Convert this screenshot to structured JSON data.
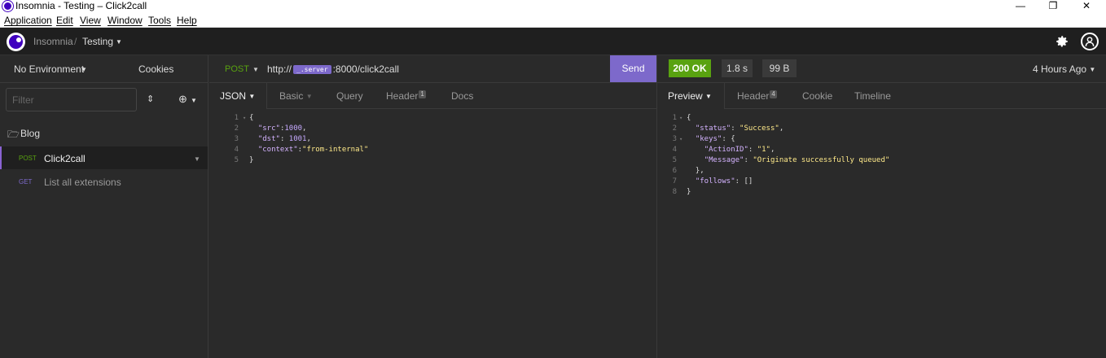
{
  "window": {
    "title": "Insomnia - Testing – Click2call",
    "controls": {
      "minimize": "—",
      "maximize": "❐",
      "close": "✕"
    }
  },
  "menu": [
    "Application",
    "Edit",
    "View",
    "Window",
    "Tools",
    "Help"
  ],
  "header": {
    "workspace_root": "Insomnia",
    "separator": "/",
    "workspace": "Testing",
    "settings_icon": "gear-icon",
    "account_icon": "user-icon"
  },
  "sidebar": {
    "environment": "No Environment",
    "cookies": "Cookies",
    "filter_placeholder": "Filter",
    "folder": "Blog",
    "requests": [
      {
        "method": "POST",
        "name": "Click2call",
        "active": true
      },
      {
        "method": "GET",
        "name": "List all extensions",
        "active": false
      }
    ]
  },
  "request": {
    "method": "POST",
    "url_prefix": "http://",
    "url_variable": "_.server",
    "url_suffix": ":8000/click2call",
    "send_label": "Send",
    "tabs": [
      {
        "label": "JSON",
        "active": true
      },
      {
        "label": "Basic"
      },
      {
        "label": "Query"
      },
      {
        "label": "Header",
        "badge": "1"
      },
      {
        "label": "Docs"
      }
    ],
    "body_lines": [
      "{",
      "  \"src\":1000,",
      "  \"dst\": 1001,",
      "  \"context\":\"from-internal\"",
      "}"
    ],
    "line_numbers": [
      "1",
      "2",
      "3",
      "4",
      "5"
    ]
  },
  "response": {
    "status": "200 OK",
    "status_color": "#59a210",
    "time": "1.8 s",
    "size": "99 B",
    "age": "4 Hours Ago",
    "tabs": [
      {
        "label": "Preview",
        "active": true
      },
      {
        "label": "Header",
        "badge": "4"
      },
      {
        "label": "Cookie"
      },
      {
        "label": "Timeline"
      }
    ],
    "body_lines": [
      "{",
      "  \"status\": \"Success\",",
      "  \"keys\": {",
      "    \"ActionID\": \"1\",",
      "    \"Message\": \"Originate successfully queued\"",
      "  },",
      "  \"follows\": []",
      "}"
    ],
    "line_numbers": [
      "1",
      "2",
      "3",
      "4",
      "5",
      "6",
      "7",
      "8"
    ]
  },
  "colors": {
    "accent": "#7d69cb",
    "post": "#59a210",
    "get": "#7d69cb"
  }
}
